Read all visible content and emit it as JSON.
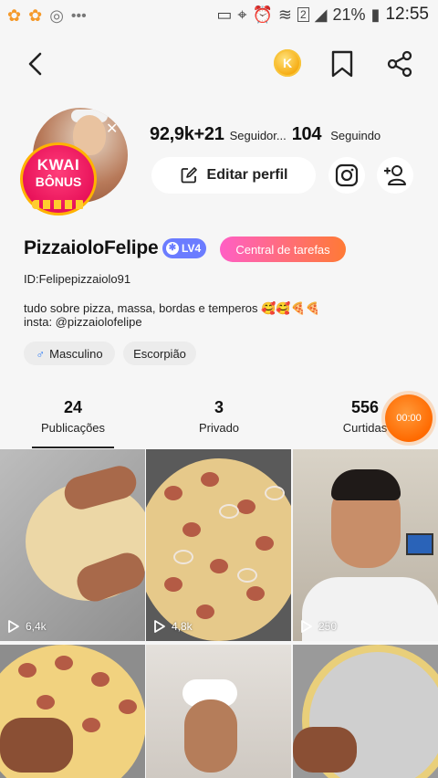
{
  "status_bar": {
    "battery": "21%",
    "time": "12:55",
    "sim_badge": "2"
  },
  "profile": {
    "avatar_badge": {
      "line1": "KWAI",
      "line2": "BÔNUS"
    },
    "followers_count": "92,9k+21",
    "followers_label": "Seguidor...",
    "following_count": "104",
    "following_label": "Seguindo",
    "edit_label": "Editar perfil",
    "username": "PizzaioloFelipe",
    "level_badge": "LV4",
    "task_center": "Central de tarefas",
    "user_id": "ID:Felipepizzaiolo91",
    "bio_line1": "tudo sobre pizza, massa, bordas e temperos 🥰🥰🍕🍕",
    "bio_line2": "insta: @pizzaiolofelipe",
    "gender": "Masculino",
    "sign": "Escorpião"
  },
  "header": {
    "coin_symbol": "K"
  },
  "tabs": [
    {
      "count": "24",
      "label": "Publicações"
    },
    {
      "count": "3",
      "label": "Privado"
    },
    {
      "count": "556",
      "label": "Curtidas"
    }
  ],
  "timer": "00:00",
  "videos": [
    {
      "views": "6,4k"
    },
    {
      "views": "4,8k"
    },
    {
      "views": "250"
    }
  ],
  "colors": {
    "task_gradient_start": "#ff5fc5",
    "task_gradient_end": "#ff7a35",
    "level_badge": "#6b7cff",
    "timer": "#ff6a00"
  }
}
